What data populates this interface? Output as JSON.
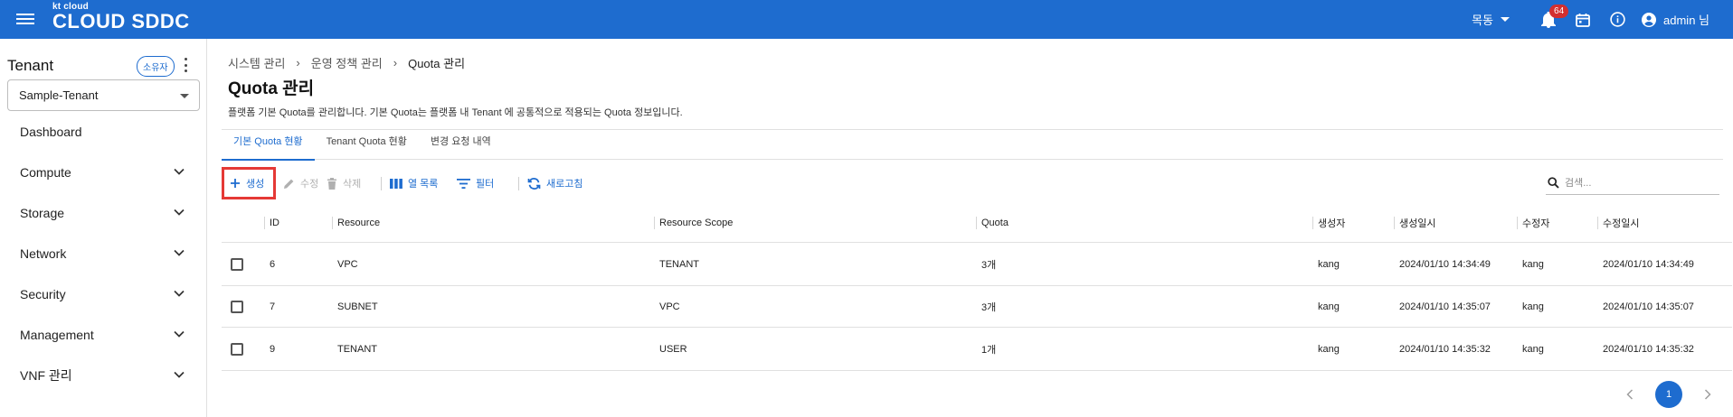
{
  "header": {
    "logo_small": "kt cloud",
    "logo_big": "CLOUD SDDC",
    "region": "목동",
    "notification_count": "64",
    "user_name": "admin 님"
  },
  "sidebar": {
    "tenant_title": "Tenant",
    "owner_chip": "소유자",
    "tenant_selected": "Sample-Tenant",
    "items": [
      {
        "label": "Dashboard",
        "expandable": false
      },
      {
        "label": "Compute",
        "expandable": true
      },
      {
        "label": "Storage",
        "expandable": true
      },
      {
        "label": "Network",
        "expandable": true
      },
      {
        "label": "Security",
        "expandable": true
      },
      {
        "label": "Management",
        "expandable": true
      },
      {
        "label": "VNF 관리",
        "expandable": true
      }
    ]
  },
  "breadcrumb": [
    "시스템 관리",
    "운영 정책 관리",
    "Quota 관리"
  ],
  "page": {
    "title": "Quota 관리",
    "description": "플랫폼 기본 Quota를 관리합니다. 기본 Quota는 플랫폼 내 Tenant 에 공통적으로 적용되는 Quota 정보입니다."
  },
  "tabs": [
    {
      "label": "기본 Quota 현황",
      "active": true
    },
    {
      "label": "Tenant Quota 현황",
      "active": false
    },
    {
      "label": "변경 요청 내역",
      "active": false
    }
  ],
  "toolbar": {
    "create": "생성",
    "edit": "수정",
    "delete": "삭제",
    "columns": "열 목록",
    "filter": "필터",
    "refresh": "새로고침",
    "search_placeholder": "검색..."
  },
  "table": {
    "columns": [
      "ID",
      "Resource",
      "Resource Scope",
      "Quota",
      "생성자",
      "생성일시",
      "수정자",
      "수정일시"
    ],
    "rows": [
      {
        "id": "6",
        "resource": "VPC",
        "scope": "TENANT",
        "quota": "3개",
        "creator": "kang",
        "created": "2024/01/10 14:34:49",
        "modifier": "kang",
        "modified": "2024/01/10 14:34:49"
      },
      {
        "id": "7",
        "resource": "SUBNET",
        "scope": "VPC",
        "quota": "3개",
        "creator": "kang",
        "created": "2024/01/10 14:35:07",
        "modifier": "kang",
        "modified": "2024/01/10 14:35:07"
      },
      {
        "id": "9",
        "resource": "TENANT",
        "scope": "USER",
        "quota": "1개",
        "creator": "kang",
        "created": "2024/01/10 14:35:32",
        "modifier": "kang",
        "modified": "2024/01/10 14:35:32"
      }
    ]
  },
  "pagination": {
    "current_page": "1"
  },
  "colors": {
    "brand": "#1e6ccf",
    "highlight": "#e53935",
    "badge": "#d32f2f"
  }
}
